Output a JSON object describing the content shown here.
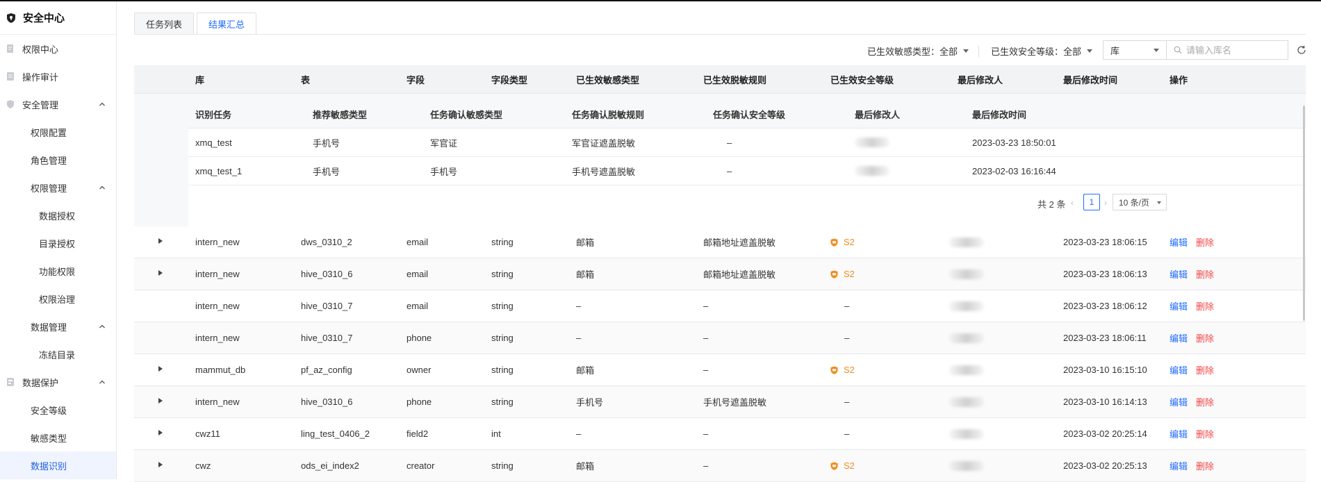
{
  "sidebar": {
    "title": "安全中心",
    "items": [
      {
        "label": "权限中心",
        "level": 0,
        "icon": "doc-edit-icon"
      },
      {
        "label": "操作审计",
        "level": 0,
        "icon": "doc-icon"
      },
      {
        "label": "安全管理",
        "level": 0,
        "icon": "shield-icon",
        "expanded": true
      },
      {
        "label": "权限配置",
        "level": 1
      },
      {
        "label": "角色管理",
        "level": 1
      },
      {
        "label": "权限管理",
        "level": 1,
        "expanded": true
      },
      {
        "label": "数据授权",
        "level": 2
      },
      {
        "label": "目录授权",
        "level": 2
      },
      {
        "label": "功能权限",
        "level": 2
      },
      {
        "label": "权限治理",
        "level": 2
      },
      {
        "label": "数据管理",
        "level": 1,
        "expanded": true
      },
      {
        "label": "冻结目录",
        "level": 2
      },
      {
        "label": "数据保护",
        "level": 0,
        "icon": "data-icon",
        "expanded": true
      },
      {
        "label": "安全等级",
        "level": 1
      },
      {
        "label": "敏感类型",
        "level": 1
      },
      {
        "label": "数据识别",
        "level": 1,
        "active": true
      }
    ]
  },
  "tabs": [
    {
      "label": "任务列表",
      "active": false
    },
    {
      "label": "结果汇总",
      "active": true
    }
  ],
  "filters": {
    "sensitive_type": "已生效敏感类型：全部",
    "security_level": "已生效安全等级：全部",
    "db_select": "库",
    "search_placeholder": "请输入库名"
  },
  "table": {
    "columns": [
      "库",
      "表",
      "字段",
      "字段类型",
      "已生效敏感类型",
      "已生效脱敏规则",
      "已生效安全等级",
      "最后修改人",
      "最后修改时间",
      "操作"
    ],
    "expanded_detail": {
      "columns": [
        "识别任务",
        "推荐敏感类型",
        "任务确认敏感类型",
        "任务确认脱敏规则",
        "任务确认安全等级",
        "最后修改人",
        "最后修改时间"
      ],
      "rows": [
        {
          "task": "xmq_test",
          "recommended": "手机号",
          "confirmed_type": "军官证",
          "confirmed_rule": "军官证遮盖脱敏",
          "confirmed_level": "–",
          "modified_by": "",
          "modified_at": "2023-03-23 18:50:01"
        },
        {
          "task": "xmq_test_1",
          "recommended": "手机号",
          "confirmed_type": "手机号",
          "confirmed_rule": "手机号遮盖脱敏",
          "confirmed_level": "–",
          "modified_by": "",
          "modified_at": "2023-02-03 16:16:44"
        }
      ],
      "pagination": {
        "total": "共 2 条",
        "page": "1",
        "page_size": "10 条/页"
      }
    },
    "rows": [
      {
        "expandable": true,
        "db": "intern_new",
        "table": "dws_0310_2",
        "field": "email",
        "type": "string",
        "sensitive": "邮箱",
        "rule": "邮箱地址遮盖脱敏",
        "level": "S2",
        "modified_by": "",
        "modified_at": "2023-03-23 18:06:15"
      },
      {
        "expandable": true,
        "db": "intern_new",
        "table": "hive_0310_6",
        "field": "email",
        "type": "string",
        "sensitive": "邮箱",
        "rule": "邮箱地址遮盖脱敏",
        "level": "S2",
        "modified_by": "",
        "modified_at": "2023-03-23 18:06:13"
      },
      {
        "expandable": false,
        "db": "intern_new",
        "table": "hive_0310_7",
        "field": "email",
        "type": "string",
        "sensitive": "–",
        "rule": "–",
        "level": "–",
        "modified_by": "",
        "modified_at": "2023-03-23 18:06:12"
      },
      {
        "expandable": false,
        "db": "intern_new",
        "table": "hive_0310_7",
        "field": "phone",
        "type": "string",
        "sensitive": "–",
        "rule": "–",
        "level": "–",
        "modified_by": "",
        "modified_at": "2023-03-23 18:06:11"
      },
      {
        "expandable": true,
        "db": "mammut_db",
        "table": "pf_az_config",
        "field": "owner",
        "type": "string",
        "sensitive": "邮箱",
        "rule": "–",
        "level": "S2",
        "modified_by": "",
        "modified_at": "2023-03-10 16:15:10"
      },
      {
        "expandable": true,
        "db": "intern_new",
        "table": "hive_0310_6",
        "field": "phone",
        "type": "string",
        "sensitive": "手机号",
        "rule": "手机号遮盖脱敏",
        "level": "–",
        "modified_by": "",
        "modified_at": "2023-03-10 16:14:13"
      },
      {
        "expandable": true,
        "db": "cwz11",
        "table": "ling_test_0406_2",
        "field": "field2",
        "type": "int",
        "sensitive": "–",
        "rule": "–",
        "level": "–",
        "modified_by": "",
        "modified_at": "2023-03-02 20:25:14"
      },
      {
        "expandable": true,
        "db": "cwz",
        "table": "ods_ei_index2",
        "field": "creator",
        "type": "string",
        "sensitive": "邮箱",
        "rule": "–",
        "level": "S2",
        "modified_by": "",
        "modified_at": "2023-03-02 20:25:13"
      }
    ],
    "actions": {
      "edit": "编辑",
      "delete": "删除"
    }
  },
  "colors": {
    "accent": "#1f6bff",
    "danger": "#f24747",
    "level_s2": "#f08c1f"
  }
}
